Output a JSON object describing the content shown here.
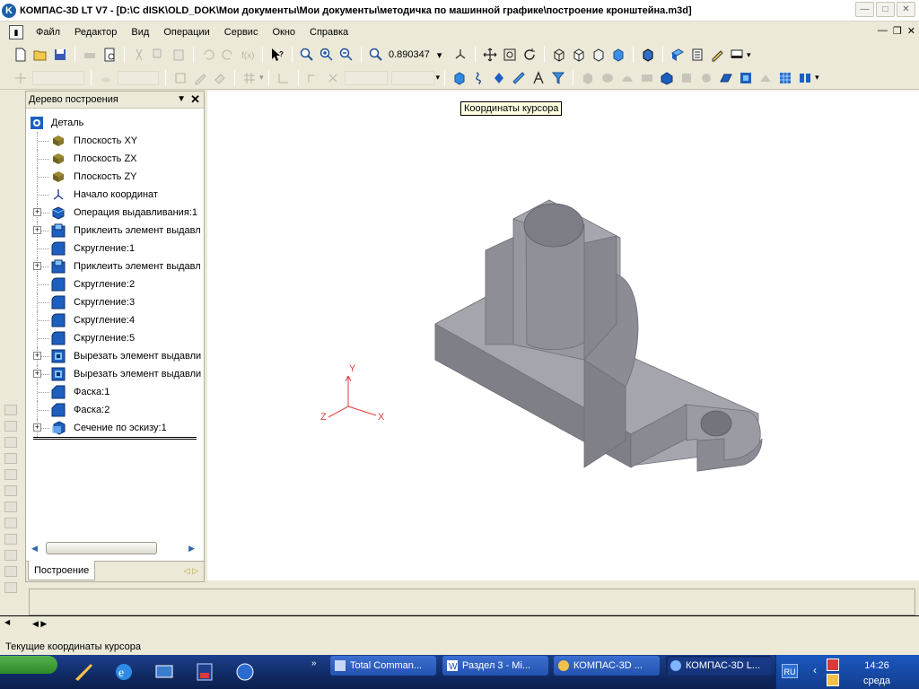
{
  "window": {
    "title": "КОМПАС-3D LT V7 - [D:\\С dISK\\OLD_DOK\\Мои документы\\Мои документы\\методичка по машинной графике\\построение кронштейна.m3d]"
  },
  "menu": {
    "items": [
      "Файл",
      "Редактор",
      "Вид",
      "Операции",
      "Сервис",
      "Окно",
      "Справка"
    ]
  },
  "toolbar": {
    "zoom_value": "0.890347"
  },
  "tree": {
    "title": "Дерево построения",
    "tab_label": "Построение",
    "items": [
      {
        "label": "Деталь",
        "icon": "part-icon",
        "expander": ""
      },
      {
        "label": "Плоскость XY",
        "icon": "plane-icon",
        "expander": ""
      },
      {
        "label": "Плоскость ZX",
        "icon": "plane-icon",
        "expander": ""
      },
      {
        "label": "Плоскость ZY",
        "icon": "plane-icon",
        "expander": ""
      },
      {
        "label": "Начало координат",
        "icon": "origin-icon",
        "expander": ""
      },
      {
        "label": "Операция выдавливания:1",
        "icon": "extrude-icon",
        "expander": "+"
      },
      {
        "label": "Приклеить элемент выдавл",
        "icon": "boss-icon",
        "expander": "+"
      },
      {
        "label": "Скругление:1",
        "icon": "fillet-icon",
        "expander": ""
      },
      {
        "label": "Приклеить элемент выдавл",
        "icon": "boss-icon",
        "expander": "+"
      },
      {
        "label": "Скругление:2",
        "icon": "fillet-icon",
        "expander": ""
      },
      {
        "label": "Скругление:3",
        "icon": "fillet-icon",
        "expander": ""
      },
      {
        "label": "Скругление:4",
        "icon": "fillet-icon",
        "expander": ""
      },
      {
        "label": "Скругление:5",
        "icon": "fillet-icon",
        "expander": ""
      },
      {
        "label": "Вырезать элемент выдавли",
        "icon": "cut-icon",
        "expander": "+"
      },
      {
        "label": "Вырезать элемент выдавли",
        "icon": "cut-icon",
        "expander": "+"
      },
      {
        "label": "Фаска:1",
        "icon": "chamfer-icon",
        "expander": ""
      },
      {
        "label": "Фаска:2",
        "icon": "chamfer-icon",
        "expander": ""
      },
      {
        "label": "Сечение по эскизу:1",
        "icon": "section-icon",
        "expander": "+"
      }
    ]
  },
  "viewport": {
    "tooltip": "Координаты курсора",
    "axes": {
      "x": "X",
      "y": "Y",
      "z": "Z"
    },
    "axis_color": "#e23b3b",
    "part_color": "#9a9aa4"
  },
  "status": {
    "text": "Текущие координаты курсора"
  },
  "taskbar": {
    "buttons": [
      {
        "label": "Total Comman...",
        "icon": "floppy-icon",
        "active": false
      },
      {
        "label": "Раздел 3 - Mi...",
        "icon": "word-icon",
        "active": false
      },
      {
        "label": "КОМПАС-3D ...",
        "icon": "kompas-icon",
        "active": false
      },
      {
        "label": "КОМПАС-3D L...",
        "icon": "kompas-icon",
        "active": true
      }
    ],
    "lang": "RU",
    "time": "14:26",
    "day": "среда"
  }
}
